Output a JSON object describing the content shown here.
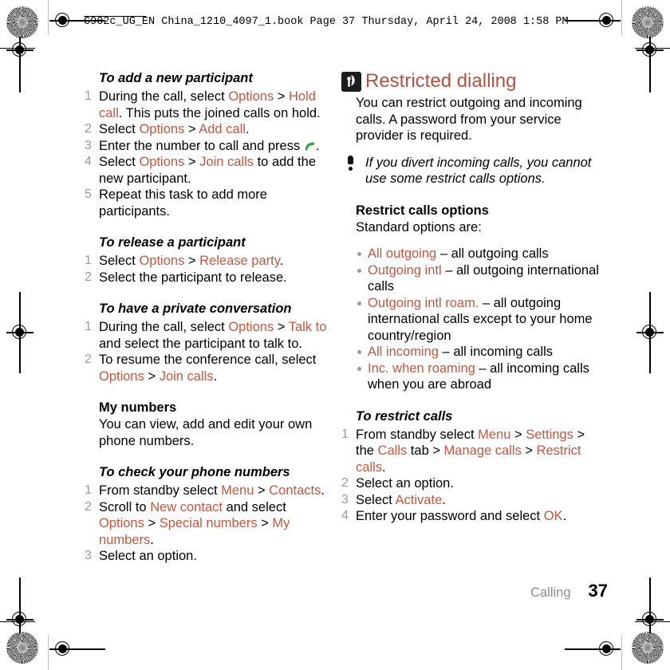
{
  "header": {
    "text": "C902c_UG_EN China_1210_4097_1.book  Page 37  Thursday, April 24, 2008  1:58 PM"
  },
  "colors": {
    "ui_term": "#c4573f",
    "heading": "#b5503f",
    "step_number": "#9a9a9a",
    "bullet": "#9a9a9a",
    "footer_chapter": "#8d8d8d",
    "call_key_icon": "#2aa64a",
    "section_icon_bg": "#1c1c1c"
  },
  "left_column": {
    "blocks": [
      {
        "type": "procedure",
        "title": "To add a new participant",
        "steps": [
          [
            {
              "t": "During the call, select ",
              "s": "plain"
            },
            {
              "t": "Options",
              "s": "ui"
            },
            {
              "t": " > ",
              "s": "plain"
            },
            {
              "t": "Hold call",
              "s": "ui"
            },
            {
              "t": ". This puts the joined calls on hold.",
              "s": "plain"
            }
          ],
          [
            {
              "t": "Select ",
              "s": "plain"
            },
            {
              "t": "Options",
              "s": "ui"
            },
            {
              "t": " > ",
              "s": "plain"
            },
            {
              "t": "Add call",
              "s": "ui"
            },
            {
              "t": ".",
              "s": "plain"
            }
          ],
          [
            {
              "t": "Enter the number to call and press ",
              "s": "plain"
            },
            {
              "t": "call-key-icon",
              "s": "icon"
            },
            {
              "t": ".",
              "s": "plain"
            }
          ],
          [
            {
              "t": "Select ",
              "s": "plain"
            },
            {
              "t": "Options",
              "s": "ui"
            },
            {
              "t": " > ",
              "s": "plain"
            },
            {
              "t": "Join calls",
              "s": "ui"
            },
            {
              "t": " to add the new participant.",
              "s": "plain"
            }
          ],
          [
            {
              "t": "Repeat this task to add more participants.",
              "s": "plain"
            }
          ]
        ]
      },
      {
        "type": "procedure",
        "title": "To release a participant",
        "steps": [
          [
            {
              "t": "Select ",
              "s": "plain"
            },
            {
              "t": "Options",
              "s": "ui"
            },
            {
              "t": " > ",
              "s": "plain"
            },
            {
              "t": "Release party",
              "s": "ui"
            },
            {
              "t": ".",
              "s": "plain"
            }
          ],
          [
            {
              "t": "Select the participant to release.",
              "s": "plain"
            }
          ]
        ]
      },
      {
        "type": "procedure",
        "title": "To have a private conversation",
        "steps": [
          [
            {
              "t": "During the call, select ",
              "s": "plain"
            },
            {
              "t": "Options",
              "s": "ui"
            },
            {
              "t": " > ",
              "s": "plain"
            },
            {
              "t": "Talk to",
              "s": "ui"
            },
            {
              "t": " and select the participant to talk to.",
              "s": "plain"
            }
          ],
          [
            {
              "t": "To resume the conference call, select ",
              "s": "plain"
            },
            {
              "t": "Options",
              "s": "ui"
            },
            {
              "t": " > ",
              "s": "plain"
            },
            {
              "t": "Join calls",
              "s": "ui"
            },
            {
              "t": ".",
              "s": "plain"
            }
          ]
        ]
      },
      {
        "type": "subsection",
        "title": "My numbers",
        "paragraph": "You can view, add and edit your own phone numbers."
      },
      {
        "type": "procedure",
        "title": "To check your phone numbers",
        "steps": [
          [
            {
              "t": "From standby select ",
              "s": "plain"
            },
            {
              "t": "Menu",
              "s": "ui"
            },
            {
              "t": " > ",
              "s": "plain"
            },
            {
              "t": "Contacts",
              "s": "ui"
            },
            {
              "t": ".",
              "s": "plain"
            }
          ],
          [
            {
              "t": "Scroll to ",
              "s": "plain"
            },
            {
              "t": "New contact",
              "s": "ui"
            },
            {
              "t": " and select ",
              "s": "plain"
            },
            {
              "t": "Options",
              "s": "ui"
            },
            {
              "t": " > ",
              "s": "plain"
            },
            {
              "t": "Special numbers",
              "s": "ui"
            },
            {
              "t": " > ",
              "s": "plain"
            },
            {
              "t": "My numbers",
              "s": "ui"
            },
            {
              "t": ".",
              "s": "plain"
            }
          ],
          [
            {
              "t": "Select an option.",
              "s": "plain"
            }
          ]
        ]
      }
    ]
  },
  "right_column": {
    "section": {
      "icon": "restricted-dialling-icon",
      "title": "Restricted dialling",
      "intro": "You can restrict outgoing and incoming calls. A password from your service provider is required."
    },
    "note": {
      "icon": "exclamation-icon",
      "text": "If you divert incoming calls, you cannot use some restrict calls options."
    },
    "options_heading": "Restrict calls options",
    "options_lead": "Standard options are:",
    "options": [
      {
        "term": "All outgoing",
        "desc": " – all outgoing calls"
      },
      {
        "term": "Outgoing intl",
        "desc": " – all outgoing international calls"
      },
      {
        "term": "Outgoing intl roam.",
        "desc": " – all outgoing international calls except to your home country/region"
      },
      {
        "term": "All incoming",
        "desc": " – all incoming calls"
      },
      {
        "term": "Inc. when roaming",
        "desc": " – all incoming calls when you are abroad"
      }
    ],
    "procedure": {
      "title": "To restrict calls",
      "steps": [
        [
          {
            "t": "From standby select ",
            "s": "plain"
          },
          {
            "t": "Menu",
            "s": "ui"
          },
          {
            "t": " > ",
            "s": "plain"
          },
          {
            "t": "Settings",
            "s": "ui"
          },
          {
            "t": " > the ",
            "s": "plain"
          },
          {
            "t": "Calls",
            "s": "ui"
          },
          {
            "t": " tab > ",
            "s": "plain"
          },
          {
            "t": "Manage calls",
            "s": "ui"
          },
          {
            "t": " > ",
            "s": "plain"
          },
          {
            "t": "Restrict calls",
            "s": "ui"
          },
          {
            "t": ".",
            "s": "plain"
          }
        ],
        [
          {
            "t": "Select an option.",
            "s": "plain"
          }
        ],
        [
          {
            "t": "Select ",
            "s": "plain"
          },
          {
            "t": "Activate",
            "s": "ui"
          },
          {
            "t": ".",
            "s": "plain"
          }
        ],
        [
          {
            "t": "Enter your password and select ",
            "s": "plain"
          },
          {
            "t": "OK",
            "s": "ui"
          },
          {
            "t": ".",
            "s": "plain"
          }
        ]
      ]
    }
  },
  "footer": {
    "chapter": "Calling",
    "page": "37"
  }
}
